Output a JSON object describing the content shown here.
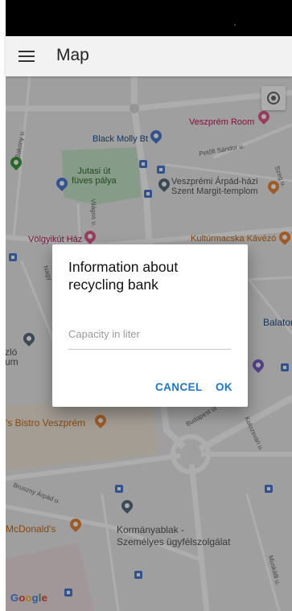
{
  "app_bar": {
    "title": "Map",
    "menu_icon": "hamburger-menu-icon"
  },
  "map": {
    "my_location_icon": "my-location-icon",
    "attribution": "Google",
    "places": {
      "veszprem_room": "Veszprém Room",
      "black_molly": "Black Molly Bt",
      "jutasi": "Jutasi út\nfüves pálya",
      "templom": "Veszprémi Árpád-házi\nSzent Margit-templom",
      "volgyikut": "Völgyikút Ház",
      "kulturmacska": "Kultúrmacska Kávézó",
      "balaton": "Balaton",
      "zlo": "zló\num",
      "bistro": "'s Bistro Veszprém",
      "mcdonalds": "McDonald's",
      "kormanyablak": "Kormányablak -\nSzemélyes ügyfélszolgálat"
    },
    "streets": {
      "petofi": "Petőfi Sándor u.",
      "budapest": "Budapest út",
      "kolozsvari": "Kolozsvári u.",
      "bruszny": "Bruszny Árpád u.",
      "vilagos": "Világos u.",
      "nagy": "Nagy",
      "bakony": "Bakony u.",
      "szeg": "Szeg u.",
      "muskatli": "Muskátli u."
    },
    "colors": {
      "land": "#ebebeb",
      "road": "#ffffff",
      "park": "#c8e6c9",
      "pink_poi": "#e05a8e",
      "blue_poi": "#4a7bd1",
      "orange_poi": "#e8863a",
      "green_poi": "#3c9b3c"
    }
  },
  "dialog": {
    "title": "Information about recycling bank",
    "input": {
      "placeholder": "Capacity in liter",
      "value": ""
    },
    "cancel_label": "CANCEL",
    "ok_label": "OK"
  },
  "google_colors": [
    "#4285F4",
    "#EA4335",
    "#FBBC05",
    "#4285F4",
    "#34A853",
    "#EA4335"
  ]
}
